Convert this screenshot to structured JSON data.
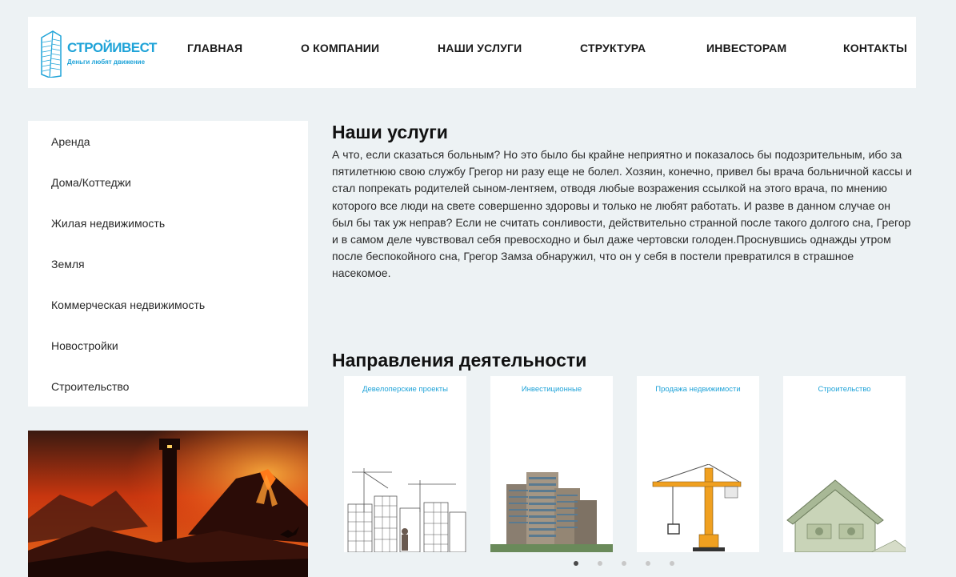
{
  "logo": {
    "name": "СТРОЙИВЕСТ",
    "tagline": "Деньги любят движение"
  },
  "nav": [
    {
      "label": "ГЛАВНАЯ"
    },
    {
      "label": "О КОМПАНИИ"
    },
    {
      "label": "НАШИ УСЛУГИ"
    },
    {
      "label": "СТРУКТУРА"
    },
    {
      "label": "ИНВЕСТОРАМ"
    },
    {
      "label": "КОНТАКТЫ"
    }
  ],
  "sidebar": {
    "items": [
      {
        "label": "Аренда"
      },
      {
        "label": "Дома/Коттеджи"
      },
      {
        "label": "Жилая недвижимость"
      },
      {
        "label": "Земля"
      },
      {
        "label": "Коммерческая недвижимость"
      },
      {
        "label": "Новостройки"
      },
      {
        "label": "Строительство"
      }
    ]
  },
  "main": {
    "title": "Наши услуги",
    "text": "А что, если сказаться больным? Но это было бы крайне неприятно и показалось бы подозрительным, ибо за пятилетнюю свою службу Грегор ни разу еще не болел. Хозяин, конечно, привел бы врача больничной кассы и стал попрекать родителей сыном-лентяем, отводя любые возражения ссылкой на этого врача, по мнению которого все люди на свете совершенно здоровы и только не любят работать. И разве в данном случае он был бы так уж неправ? Если не считать сонливости, действительно странной после такого долгого сна, Грегор и в самом деле чувствовал себя превосходно и был даже чертовски голоден.Проснувшись однажды утром после беспокойного сна, Грегор Замза обнаружил, что он у себя в постели превратился в страшное насекомое.",
    "directions_title": "Направления деятельности",
    "cards": [
      {
        "title": "Девелоперские проекты",
        "icon": "sketch-city-image"
      },
      {
        "title": "Инвестиционные",
        "icon": "skyscraper-image"
      },
      {
        "title": "Продажа недвижимости",
        "icon": "crane-image"
      },
      {
        "title": "Строительство",
        "icon": "money-house-image"
      }
    ],
    "carousel": {
      "pages": 5,
      "active": 1
    }
  },
  "colors": {
    "accent": "#1fa3d8",
    "background": "#edf2f4"
  }
}
